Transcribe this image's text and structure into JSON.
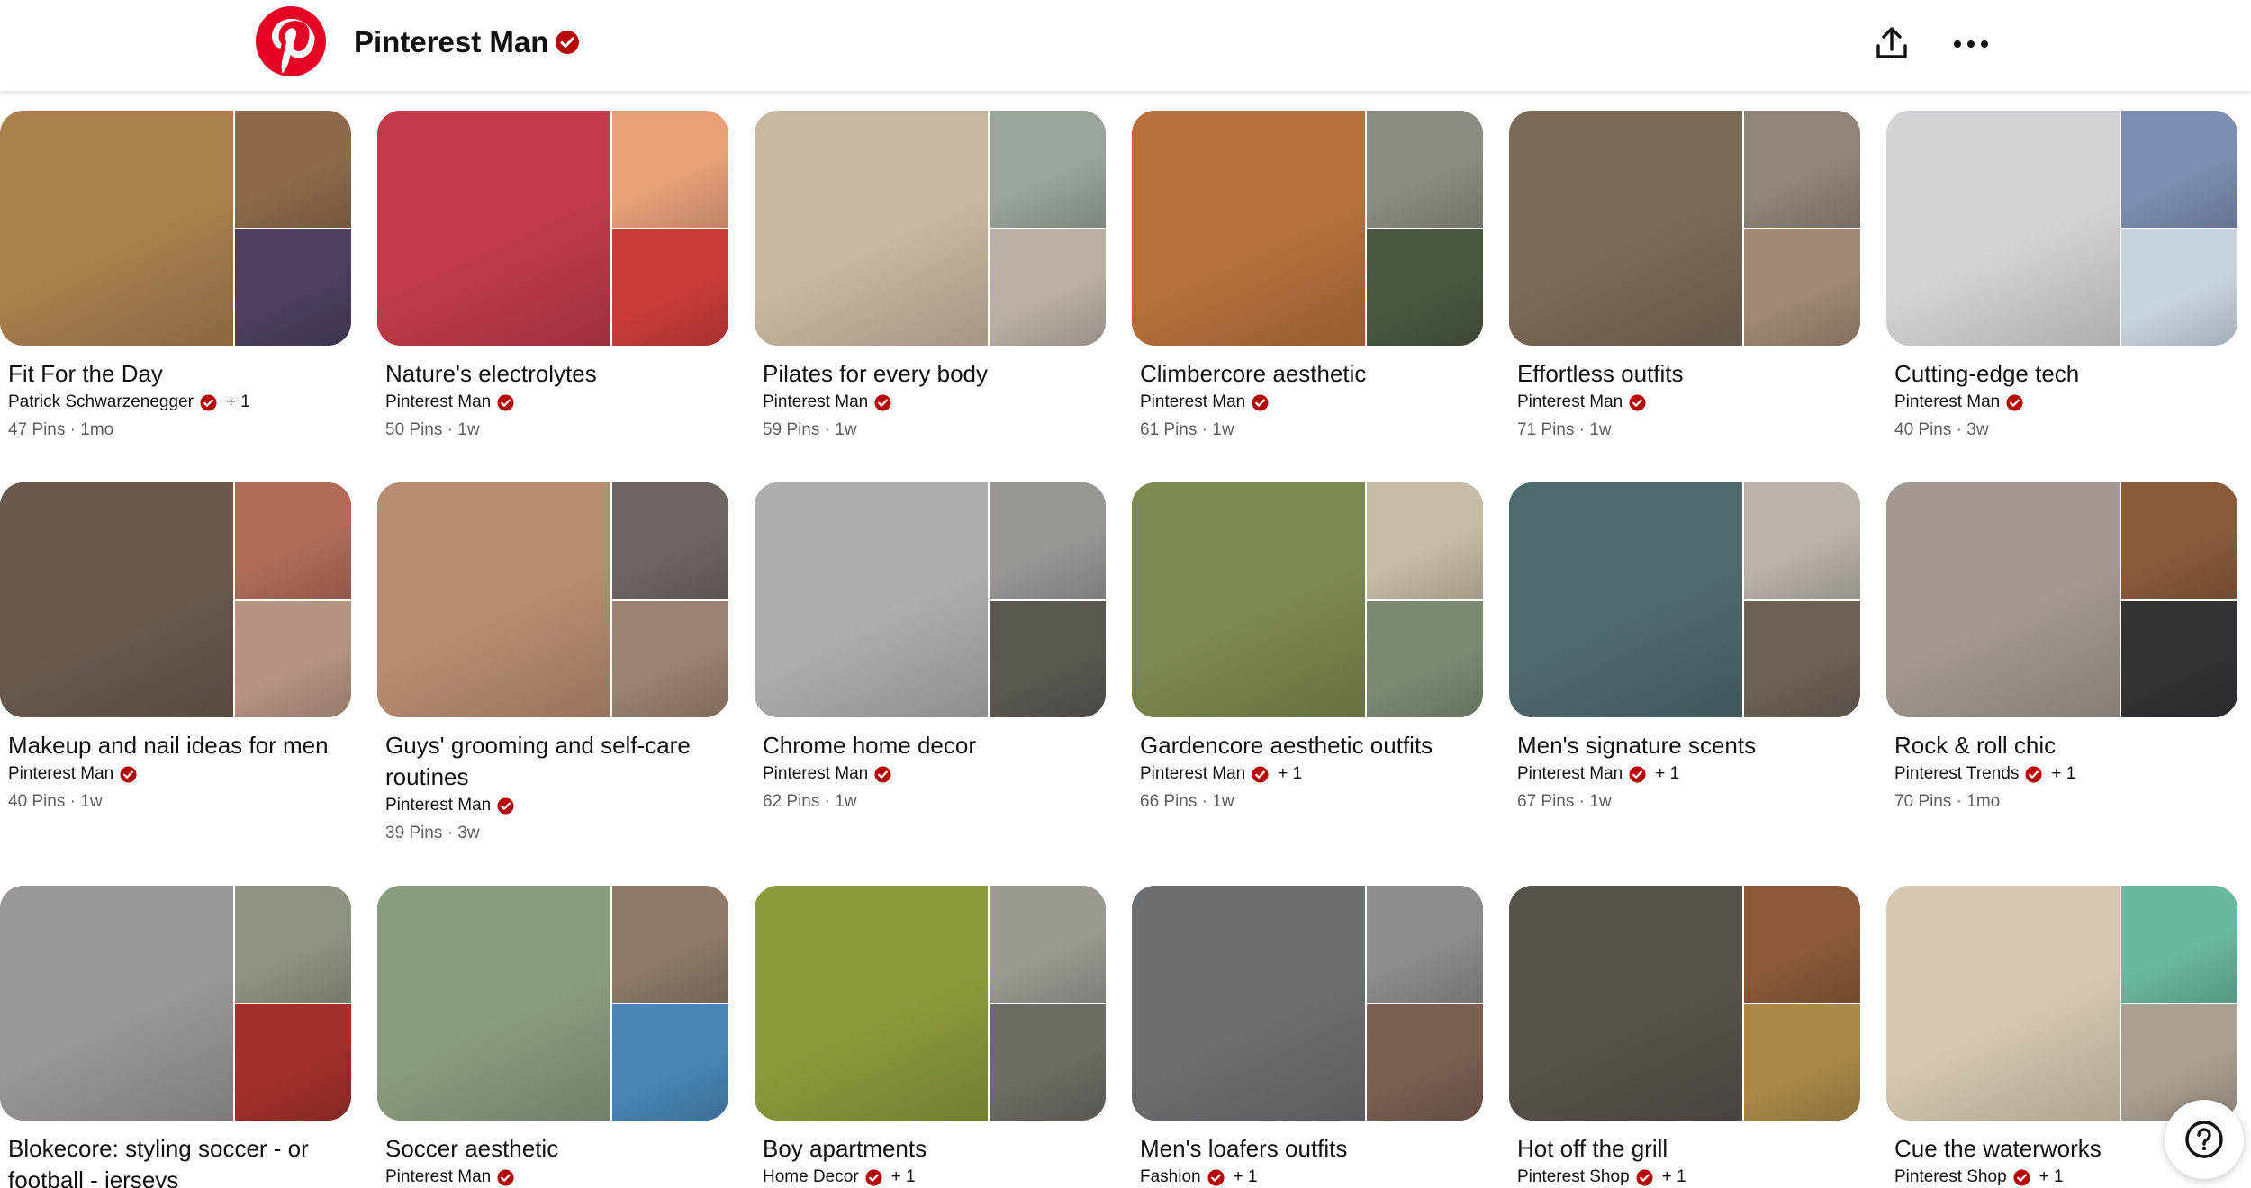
{
  "header": {
    "title": "Pinterest Man",
    "verified_icon": "verified-check-icon",
    "share_icon": "share-upload-icon",
    "more_icon": "more-ellipsis-icon",
    "logo_icon": "pinterest-logo-icon"
  },
  "help": {
    "label": "?",
    "icon": "help-question-icon"
  },
  "colors": {
    "brand": "#e60023",
    "verified": "#b60000"
  },
  "boards": [
    {
      "name": "Fit For the Day",
      "owner": "Patrick Schwarzenegger",
      "collab": "+ 1",
      "pins": "47 Pins",
      "updated": "1mo",
      "thumbs": [
        "#a8804f",
        "#8d6a4c",
        "#4c3f60"
      ]
    },
    {
      "name": "Nature's electrolytes",
      "owner": "Pinterest Man",
      "collab": "",
      "pins": "50 Pins",
      "updated": "1w",
      "thumbs": [
        "#c13b4a",
        "#e9a07a",
        "#c93c3a"
      ]
    },
    {
      "name": "Pilates for every body",
      "owner": "Pinterest Man",
      "collab": "",
      "pins": "59 Pins",
      "updated": "1w",
      "thumbs": [
        "#c9b8a0",
        "#9aa49a",
        "#b8b0a4"
      ]
    },
    {
      "name": "Climbercore aesthetic",
      "owner": "Pinterest Man",
      "collab": "",
      "pins": "61 Pins",
      "updated": "1w",
      "thumbs": [
        "#b8713c",
        "#8b8c82",
        "#4a5640"
      ]
    },
    {
      "name": "Effortless outfits",
      "owner": "Pinterest Man",
      "collab": "",
      "pins": "71 Pins",
      "updated": "1w",
      "thumbs": [
        "#7b6a58",
        "#8f8579",
        "#a08872"
      ]
    },
    {
      "name": "Cutting-edge tech",
      "owner": "Pinterest Man",
      "collab": "",
      "pins": "40 Pins",
      "updated": "3w",
      "thumbs": [
        "#d4d4d6",
        "#7d8eb0",
        "#c8d4dc"
      ]
    },
    {
      "name": "Makeup and nail ideas for men",
      "owner": "Pinterest Man",
      "collab": "",
      "pins": "40 Pins",
      "updated": "1w",
      "thumbs": [
        "#6a5a4e",
        "#b06b5a",
        "#b59482"
      ]
    },
    {
      "name": "Guys' grooming and self-care routines",
      "owner": "Pinterest Man",
      "collab": "",
      "pins": "39 Pins",
      "updated": "3w",
      "thumbs": [
        "#b88c72",
        "#6e6662",
        "#9c8070"
      ]
    },
    {
      "name": "Chrome home decor",
      "owner": "Pinterest Man",
      "collab": "",
      "pins": "62 Pins",
      "updated": "1w",
      "thumbs": [
        "#aeaeae",
        "#9a9793",
        "#5b5852"
      ]
    },
    {
      "name": "Gardencore aesthetic outfits",
      "owner": "Pinterest Man",
      "collab": "+ 1",
      "pins": "66 Pins",
      "updated": "1w",
      "thumbs": [
        "#7b8a4e",
        "#c4bca6",
        "#7c8a74"
      ]
    },
    {
      "name": "Men's signature scents",
      "owner": "Pinterest Man",
      "collab": "+ 1",
      "pins": "67 Pins",
      "updated": "1w",
      "thumbs": [
        "#4f6a6e",
        "#b8b2a8",
        "#6b6256"
      ]
    },
    {
      "name": "Rock & roll chic",
      "owner": "Pinterest Trends",
      "collab": "+ 1",
      "pins": "70 Pins",
      "updated": "1mo",
      "thumbs": [
        "#a29a90",
        "#8a5a3c",
        "#333336"
      ]
    },
    {
      "name": "Blokecore: styling soccer - or football - jerseys",
      "owner": "",
      "collab": "",
      "pins": "",
      "updated": "",
      "thumbs": [
        "#9a9896",
        "#8e9482",
        "#a0302c"
      ]
    },
    {
      "name": "Soccer aesthetic",
      "owner": "Pinterest Man",
      "collab": "",
      "pins": "",
      "updated": "",
      "thumbs": [
        "#8a9c80",
        "#8d7a6a",
        "#4a86b4"
      ]
    },
    {
      "name": "Boy apartments",
      "owner": "Home Decor",
      "collab": "+ 1",
      "pins": "",
      "updated": "",
      "thumbs": [
        "#8c9a3c",
        "#9c9892",
        "#6e6a64"
      ]
    },
    {
      "name": "Men's loafers outfits",
      "owner": "Fashion",
      "collab": "+ 1",
      "pins": "",
      "updated": "",
      "thumbs": [
        "#6d7072",
        "#8c8c88",
        "#7a5e52"
      ]
    },
    {
      "name": "Hot off the grill",
      "owner": "Pinterest Shop",
      "collab": "+ 1",
      "pins": "",
      "updated": "",
      "thumbs": [
        "#58524c",
        "#8a5a3a",
        "#a88a48"
      ]
    },
    {
      "name": "Cue the waterworks",
      "owner": "Pinterest Shop",
      "collab": "+ 1",
      "pins": "",
      "updated": "",
      "thumbs": [
        "#d6c8b0",
        "#6ab8a0",
        "#a8a090"
      ]
    }
  ]
}
